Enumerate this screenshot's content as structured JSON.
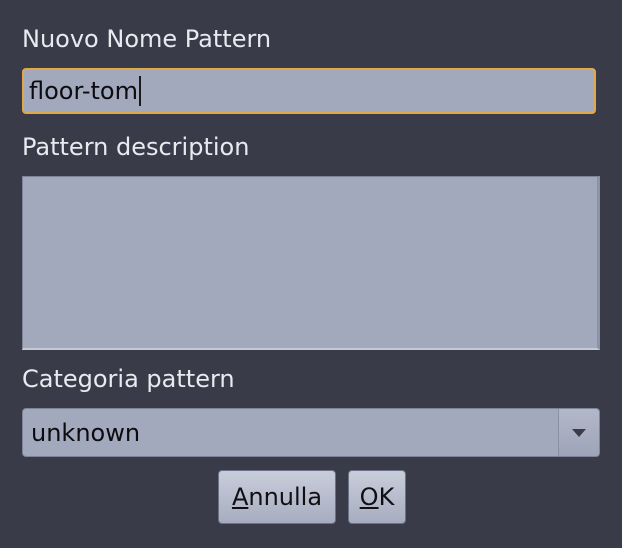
{
  "dialog": {
    "name_label": "Nuovo Nome Pattern",
    "name_value": "floor-tom",
    "description_label": "Pattern description",
    "description_value": "",
    "category_label": "Categoria pattern",
    "category_value": "unknown"
  },
  "buttons": {
    "cancel_mnemonic": "A",
    "cancel_rest": "nnulla",
    "ok_mnemonic": "O",
    "ok_rest": "K"
  },
  "icons": {
    "combo_arrow": "chevron-down-icon"
  },
  "colors": {
    "background": "#393c48",
    "field": "#a3a9bd",
    "focus_border": "#e0a945"
  }
}
